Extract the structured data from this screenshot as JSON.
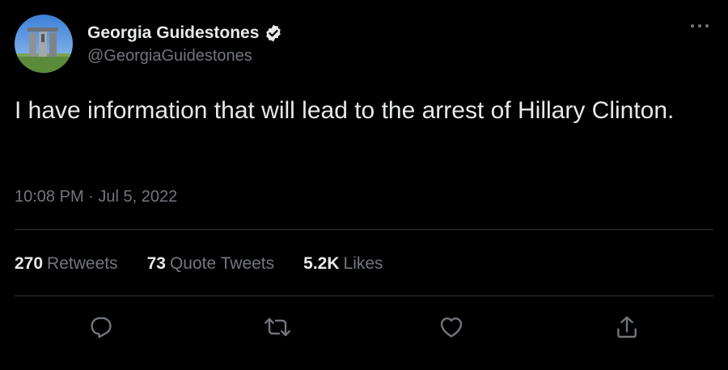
{
  "author": {
    "display_name": "Georgia Guidestones",
    "handle": "@GeorgiaGuidestones",
    "verified": true,
    "avatar_icon": "guidestones-photo"
  },
  "tweet": {
    "text": "I have information that will lead to the arrest of Hillary Clinton.",
    "time": "10:08 PM",
    "separator": "·",
    "date": "Jul 5, 2022"
  },
  "stats": {
    "retweets_count": "270",
    "retweets_label": "Retweets",
    "quotes_count": "73",
    "quotes_label": "Quote Tweets",
    "likes_count": "5.2K",
    "likes_label": "Likes"
  },
  "actions": {
    "reply_icon": "reply-icon",
    "retweet_icon": "retweet-icon",
    "like_icon": "heart-icon",
    "share_icon": "share-icon"
  },
  "colors": {
    "background": "#000000",
    "text_primary": "#e7e9ea",
    "text_secondary": "#71767b",
    "divider": "#2f3336"
  }
}
